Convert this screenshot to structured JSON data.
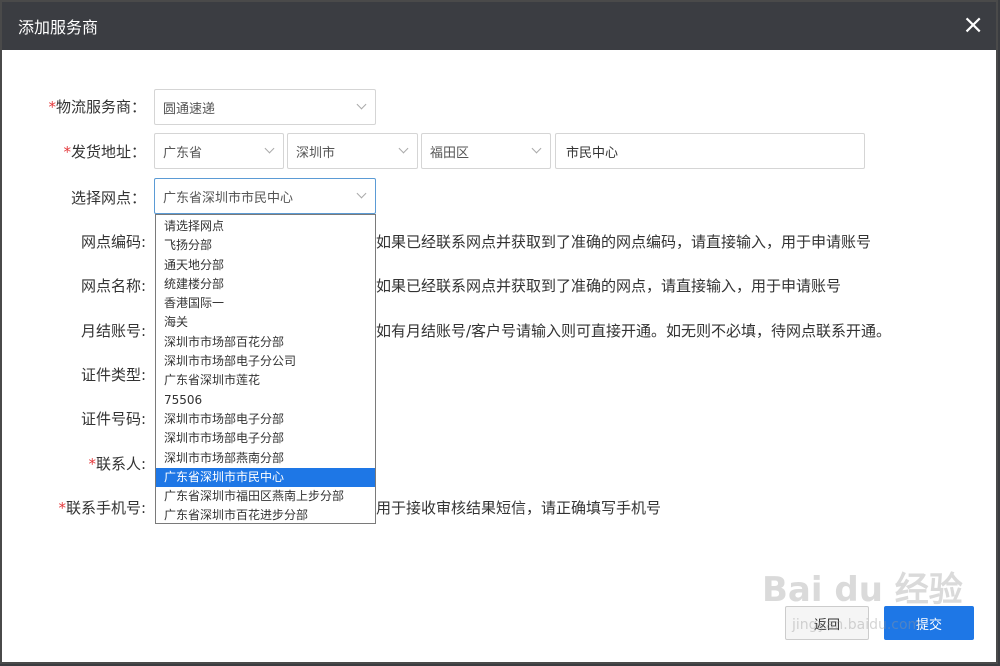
{
  "dialog": {
    "title": "添加服务商",
    "close_icon": "×"
  },
  "form": {
    "logistics": {
      "label": "物流服务商：",
      "value": "圆通速递"
    },
    "address": {
      "label": "发货地址：",
      "province": "广东省",
      "city": "深圳市",
      "district": "福田区",
      "detail": "市民中心"
    },
    "branch": {
      "label": "选择网点：",
      "value": "广东省深圳市市民中心"
    },
    "branch_code": {
      "label": "网点编码:",
      "hint": "如果已经联系网点并获取到了准确的网点编码，请直接输入，用于申请账号"
    },
    "branch_name": {
      "label": "网点名称:",
      "hint": "如果已经联系网点并获取到了准确的网点，请直接输入，用于申请账号"
    },
    "monthly_account": {
      "label": "月结账号:",
      "hint": "如有月结账号/客户号请输入则可直接开通。如无则不必填，待网点联系开通。"
    },
    "id_type": {
      "label": "证件类型:"
    },
    "id_number": {
      "label": "证件号码:"
    },
    "contact": {
      "label": "联系人:"
    },
    "phone": {
      "label": "联系手机号:",
      "hint": "用于接收审核结果短信，请正确填写手机号"
    },
    "required_mark": "*"
  },
  "dropdown": {
    "options": [
      "请选择网点",
      "飞扬分部",
      "通天地分部",
      "统建楼分部",
      "香港国际一",
      "海关",
      "深圳市市场部百花分部",
      "深圳市市场部电子分公司",
      "广东省深圳市莲花",
      "75506",
      "深圳市市场部电子分部",
      "深圳市市场部电子分部",
      "深圳市市场部燕南分部",
      "广东省深圳市市民中心",
      "广东省深圳市福田区燕南上步分部",
      "广东省深圳市百花进步分部"
    ],
    "selected_index": 13
  },
  "buttons": {
    "back": "返回",
    "submit": "提交"
  },
  "watermark": {
    "main": "Bai du 经验",
    "sub": "jingyan.baidu.com"
  },
  "colors": {
    "titlebar": "#3b3d42",
    "accent": "#1e77e6",
    "required": "#e4393c"
  }
}
